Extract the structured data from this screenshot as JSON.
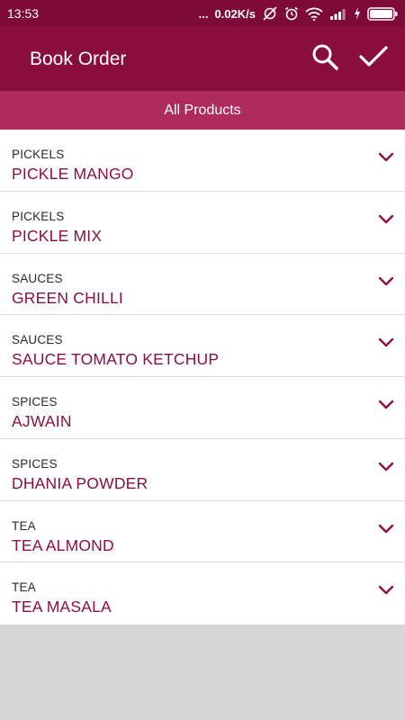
{
  "status_bar": {
    "time": "13:53",
    "dots": "...",
    "speed": "0.02K/s"
  },
  "app_bar": {
    "title": "Book Order",
    "search_icon": "search-icon",
    "confirm_icon": "check-icon"
  },
  "tab": {
    "label": "All Products"
  },
  "products": [
    {
      "category": "PICKELS",
      "name": "PICKLE MANGO"
    },
    {
      "category": "PICKELS",
      "name": "PICKLE MIX"
    },
    {
      "category": "SAUCES",
      "name": "GREEN CHILLI"
    },
    {
      "category": "SAUCES",
      "name": "SAUCE TOMATO KETCHUP"
    },
    {
      "category": "SPICES",
      "name": "AJWAIN"
    },
    {
      "category": "SPICES",
      "name": "DHANIA POWDER"
    },
    {
      "category": "TEA",
      "name": "TEA ALMOND"
    },
    {
      "category": "TEA",
      "name": "TEA MASALA"
    }
  ],
  "colors": {
    "status_bar": "#7d0a38",
    "app_bar": "#890d3f",
    "tab_bar": "#ad2b5d",
    "accent_text": "#8c0f44",
    "empty_area": "#d6d6d6"
  }
}
